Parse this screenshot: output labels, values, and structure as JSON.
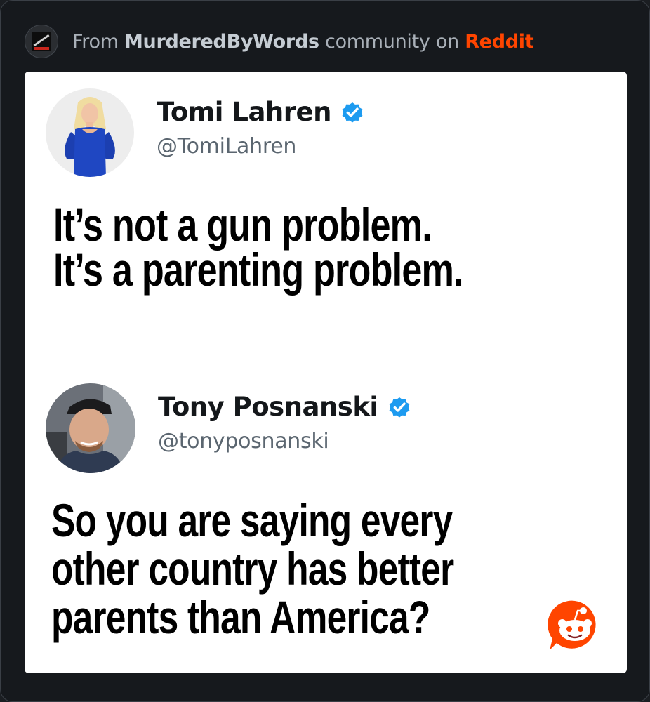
{
  "header": {
    "prefix": "From ",
    "community": "MurderedByWords",
    "middle": " community on ",
    "platform": "Reddit"
  },
  "tweets": [
    {
      "display_name": "Tomi Lahren",
      "handle": "@TomiLahren",
      "verified": true,
      "text": "It’s not a gun problem.\nIt’s a parenting problem."
    },
    {
      "display_name": "Tony Posnanski",
      "handle": "@tonyposnanski",
      "verified": true,
      "text": "So you are saying every\nother country has better\nparents than America?"
    }
  ],
  "colors": {
    "reddit_orange": "#ff4500",
    "verified_blue": "#1da1f2",
    "background": "#16191d"
  },
  "icons": {
    "community_avatar": "community-avatar",
    "verified": "verified-badge-icon",
    "reddit_logo": "reddit-snoo-icon"
  }
}
